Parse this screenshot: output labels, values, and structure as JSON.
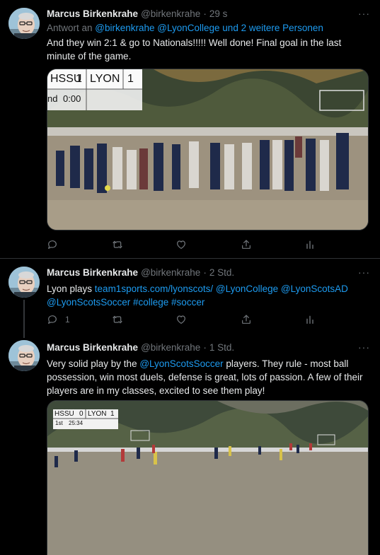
{
  "tweets": [
    {
      "name": "Marcus Birkenkrahe",
      "handle": "@birkenkrahe",
      "dot": "·",
      "time": "29 s",
      "more": "···",
      "reply_prefix": "Antwort an ",
      "reply_mentions": "@birkenkrahe @LyonCollege und 2 weitere Personen",
      "text": "And they win 2:1 & go to Nationals!!!!! Well done! Final goal in the last minute of the game.",
      "scoreboard": {
        "home": "HSSU",
        "home_score": "1",
        "away": "LYON",
        "away_score": "1",
        "period": "nd",
        "clock": "0:00"
      },
      "reply_count": "",
      "retweet_count": "",
      "like_count": ""
    },
    {
      "name": "Marcus Birkenkrahe",
      "handle": "@birkenkrahe",
      "dot": "·",
      "time": "2 Std.",
      "more": "···",
      "text_prefix": "Lyon plays ",
      "text_links": "team1sports.com/lyonscots/ @LyonCollege @LyonScotsAD @LyonScotsSoccer #college #soccer",
      "reply_count": "1",
      "retweet_count": "",
      "like_count": ""
    },
    {
      "name": "Marcus Birkenkrahe",
      "handle": "@birkenkrahe",
      "dot": "·",
      "time": "1 Std.",
      "more": "···",
      "text_a": "Very solid play by the ",
      "text_mention": "@LyonScotsSoccer",
      "text_b": " players. They rule - most ball possession, win most duels, defense is great, lots of passion. A few of their players are in my classes, excited to see them play!",
      "scoreboard": {
        "home": "HSSU",
        "home_score": "0",
        "away": "LYON",
        "away_score": "1",
        "period": "1st",
        "clock": "25:34"
      }
    }
  ],
  "colors": {
    "background": "#000000",
    "text": "#e7e9ea",
    "muted": "#71767b",
    "link": "#1d9bf0",
    "divider": "#2f3336"
  },
  "icons": [
    "reply-icon",
    "retweet-icon",
    "like-icon",
    "share-icon",
    "analytics-icon",
    "more-icon"
  ]
}
